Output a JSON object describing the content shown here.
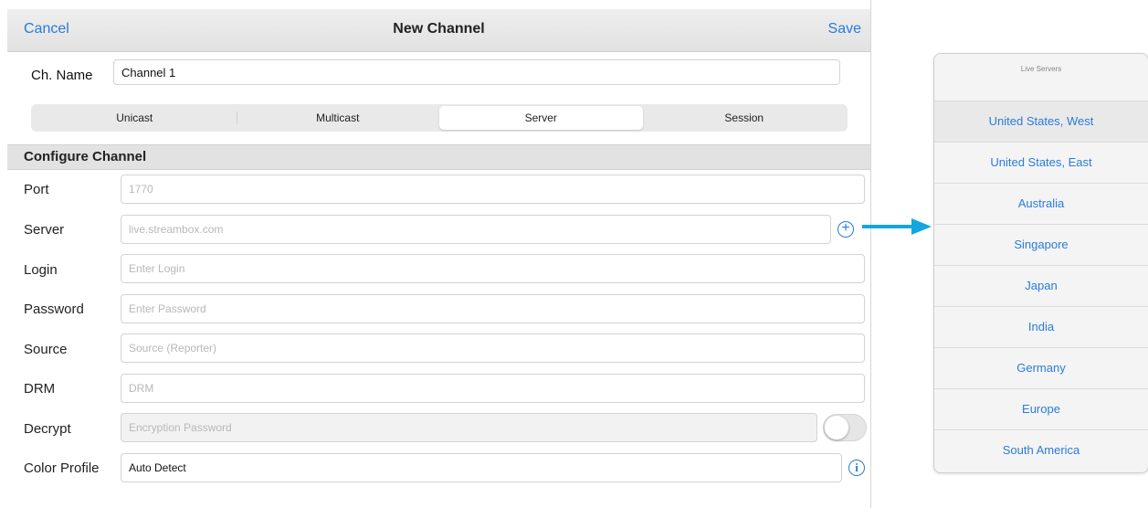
{
  "navbar": {
    "cancel_label": "Cancel",
    "title": "New Channel",
    "save_label": "Save"
  },
  "channel_name": {
    "label": "Ch. Name",
    "value": "Channel 1"
  },
  "modes": {
    "selected": "Server",
    "items": [
      "Unicast",
      "Multicast",
      "Server",
      "Session"
    ]
  },
  "configure": {
    "title": "Configure Channel",
    "port": {
      "label": "Port",
      "placeholder": "1770"
    },
    "server": {
      "label": "Server",
      "placeholder": "live.streambox.com",
      "icon": "plus-circle-icon"
    },
    "login": {
      "label": "Login",
      "placeholder": "Enter Login"
    },
    "password": {
      "label": "Password",
      "placeholder": "Enter Password"
    },
    "source": {
      "label": "Source",
      "placeholder": "Source (Reporter)"
    },
    "drm": {
      "label": "DRM",
      "placeholder": "DRM"
    },
    "decrypt": {
      "label": "Decrypt",
      "placeholder": "Encryption Password",
      "enabled": false
    },
    "color_profile": {
      "label": "Color Profile",
      "value": "Auto Detect",
      "icon": "info-icon"
    }
  },
  "live_servers": {
    "title": "Live Servers",
    "selected": "United States, West",
    "items": [
      "United States, West",
      "United States, East",
      "Australia",
      "Singapore",
      "Japan",
      "India",
      "Germany",
      "Europe",
      "South America"
    ]
  },
  "colors": {
    "accent": "#2a7bd9",
    "arrow": "#12a7e0",
    "navbar": "#e8e8e8"
  }
}
